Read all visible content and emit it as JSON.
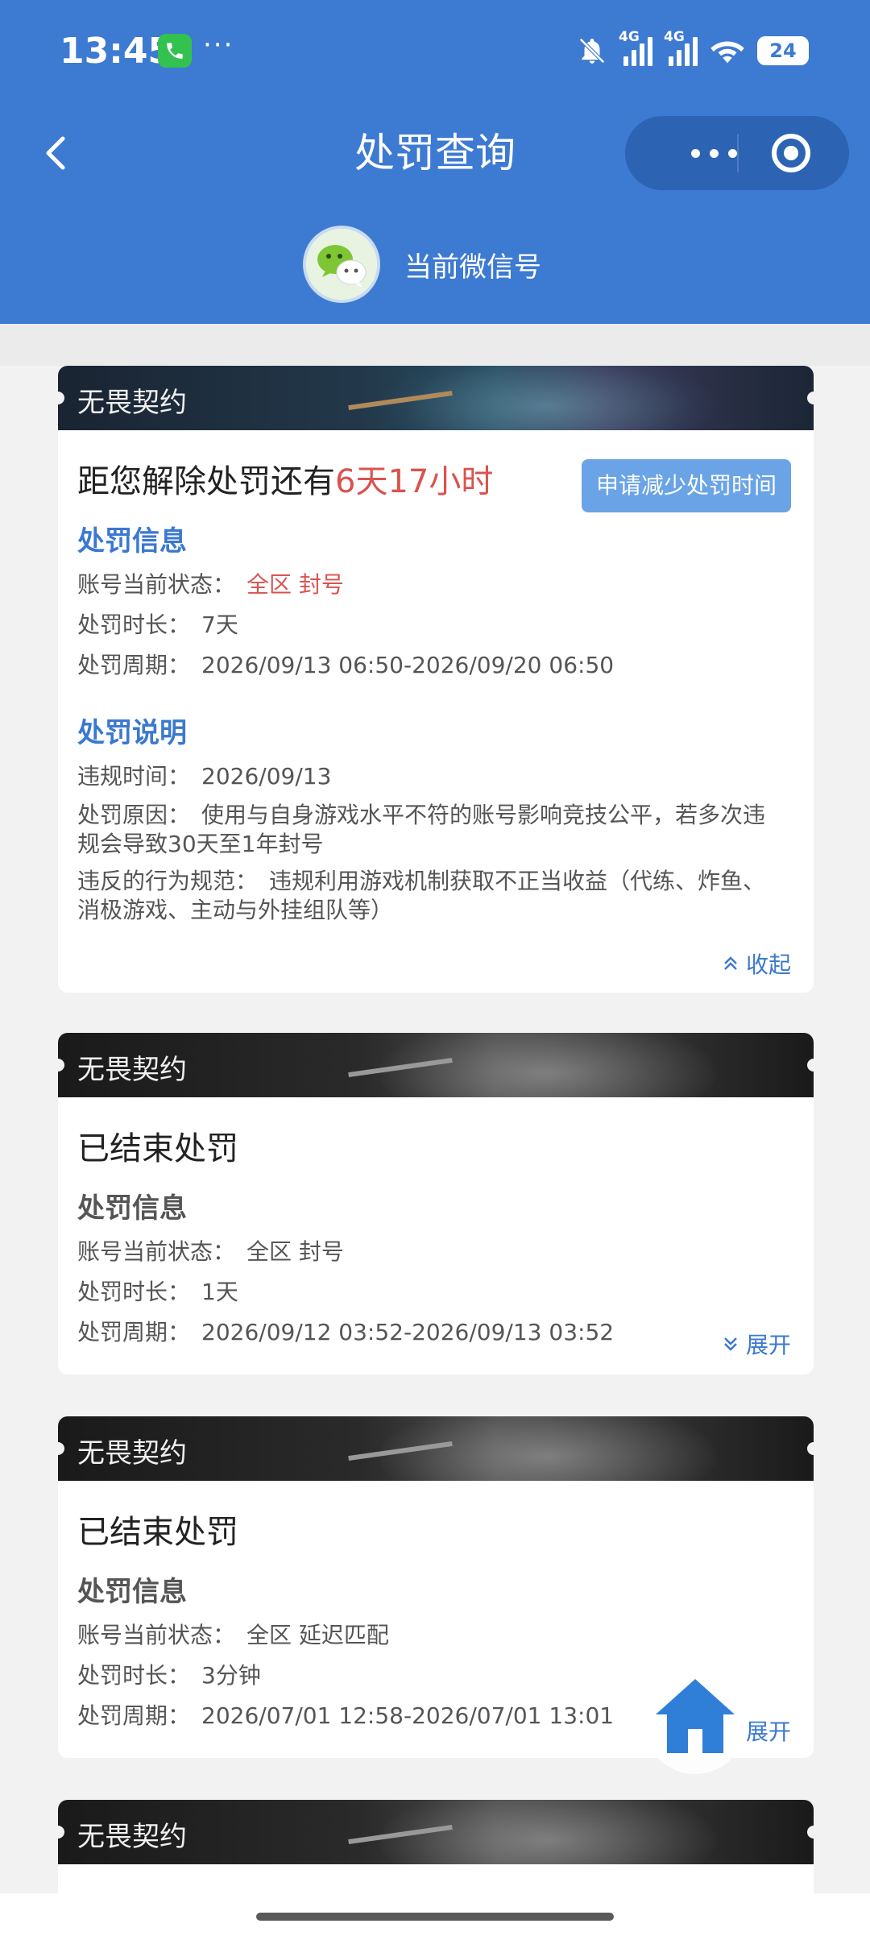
{
  "status_bar": {
    "time": "13:45",
    "more": "···",
    "signal1": "4G",
    "signal2": "4G",
    "wifi_sub": "6",
    "battery": "24"
  },
  "nav": {
    "title": "处罚查询"
  },
  "account": {
    "label": "当前微信号"
  },
  "cards": [
    {
      "game": "无畏契约",
      "countdown_prefix": "距您解除处罚还有",
      "countdown_value": "6天17小时",
      "apply_button": "申请减少处罚时间",
      "info_title": "处罚信息",
      "status_label": "账号当前状态：",
      "status_value": "全区 封号",
      "duration_label": "处罚时长：",
      "duration_value": "7天",
      "period_label": "处罚周期：",
      "period_value": "2026/09/13 06:50-2026/09/20 06:50",
      "desc_title": "处罚说明",
      "violation_time_label": "违规时间：",
      "violation_time_value": "2026/09/13",
      "reason_label": "处罚原因：",
      "reason_value": "使用与自身游戏水平不符的账号影响竞技公平，若多次违规会导致30天至1年封号",
      "rule_label": "违反的行为规范：",
      "rule_value": "违规利用游戏机制获取不正当收益（代练、炸鱼、消极游戏、主动与外挂组队等）",
      "toggle": "收起"
    },
    {
      "game": "无畏契约",
      "headline": "已结束处罚",
      "info_title": "处罚信息",
      "status_label": "账号当前状态：",
      "status_value": "全区 封号",
      "duration_label": "处罚时长：",
      "duration_value": "1天",
      "period_label": "处罚周期：",
      "period_value": "2026/09/12 03:52-2026/09/13 03:52",
      "toggle": "展开"
    },
    {
      "game": "无畏契约",
      "headline": "已结束处罚",
      "info_title": "处罚信息",
      "status_label": "账号当前状态：",
      "status_value": "全区 延迟匹配",
      "duration_label": "处罚时长：",
      "duration_value": "3分钟",
      "period_label": "处罚周期：",
      "period_value": "2026/07/01 12:58-2026/07/01 13:01",
      "toggle": "展开"
    },
    {
      "game": "无畏契约"
    }
  ],
  "colors": {
    "header_blue": "#3d7ad2",
    "accent_blue": "#3b78d0",
    "warning_red": "#d9534f",
    "apply_button": "#6aa4e6"
  },
  "icons": [
    "phone-call-icon",
    "mute-bell-icon",
    "wifi-icon",
    "back-arrow-icon",
    "more-dots-icon",
    "target-icon",
    "wechat-logo-icon",
    "chevron-up-icon",
    "chevron-down-icon",
    "home-icon"
  ]
}
